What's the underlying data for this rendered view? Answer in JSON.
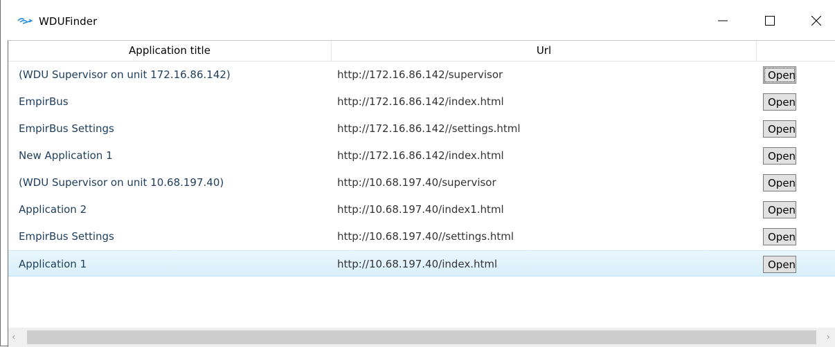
{
  "window": {
    "title": "WDUFinder"
  },
  "columns": [
    "Application title",
    "Url",
    ""
  ],
  "open_label": "Open",
  "rows": [
    {
      "title": "(WDU Supervisor on unit 172.16.86.142)",
      "url": "http://172.16.86.142/supervisor"
    },
    {
      "title": "EmpirBus",
      "url": "http://172.16.86.142/index.html"
    },
    {
      "title": "EmpirBus Settings",
      "url": "http://172.16.86.142//settings.html"
    },
    {
      "title": "New Application 1",
      "url": "http://172.16.86.142/index.html"
    },
    {
      "title": "(WDU Supervisor on unit 10.68.197.40)",
      "url": "http://10.68.197.40/supervisor"
    },
    {
      "title": "Application 2",
      "url": "http://10.68.197.40/index1.html"
    },
    {
      "title": "EmpirBus Settings",
      "url": "http://10.68.197.40//settings.html"
    },
    {
      "title": "Application 1",
      "url": "http://10.68.197.40/index.html"
    }
  ],
  "selected_row": 7,
  "focused_button": 0,
  "colors": {
    "selection": "#d9f0fc",
    "button": "#e1e1e1",
    "text": "#1e3d5c"
  },
  "icons": {
    "app": "app-icon",
    "minimize": "minimize-icon",
    "maximize": "maximize-icon",
    "close": "close-icon",
    "scroll_left": "chevron-left-icon",
    "scroll_right": "chevron-right-icon"
  }
}
